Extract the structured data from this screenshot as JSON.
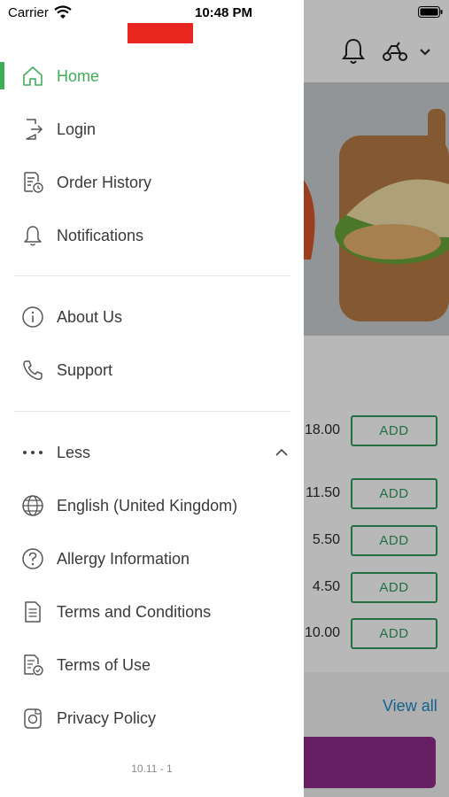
{
  "status_bar": {
    "carrier": "Carrier",
    "time": "10:48 PM"
  },
  "drawer": {
    "menu": [
      {
        "label": "Home",
        "icon": "home-icon",
        "active": true
      },
      {
        "label": "Login",
        "icon": "login-icon"
      },
      {
        "label": "Order History",
        "icon": "order-history-icon"
      },
      {
        "label": "Notifications",
        "icon": "bell-icon"
      }
    ],
    "info": [
      {
        "label": "About Us",
        "icon": "info-icon"
      },
      {
        "label": "Support",
        "icon": "phone-icon"
      }
    ],
    "less_label": "Less",
    "more": [
      {
        "label": "English (United Kingdom)",
        "icon": "globe-icon"
      },
      {
        "label": "Allergy Information",
        "icon": "question-icon"
      },
      {
        "label": "Terms and Conditions",
        "icon": "document-icon"
      },
      {
        "label": "Terms of Use",
        "icon": "document-check-icon"
      },
      {
        "label": "Privacy Policy",
        "icon": "privacy-icon"
      }
    ],
    "version": "10.11 - 1"
  },
  "background": {
    "items": [
      {
        "price": "18.00",
        "button": "ADD"
      },
      {
        "price": "11.50",
        "button": "ADD"
      },
      {
        "price": "5.50",
        "button": "ADD"
      },
      {
        "price": "4.50",
        "button": "ADD"
      },
      {
        "price": "10.00",
        "button": "ADD"
      }
    ],
    "view_all": "View all"
  },
  "colors": {
    "active": "#3fae58",
    "add_button": "#2e9a5e",
    "link": "#1f88c7",
    "cart_bar": "#8e2b8a",
    "logo": "#e8251f"
  }
}
